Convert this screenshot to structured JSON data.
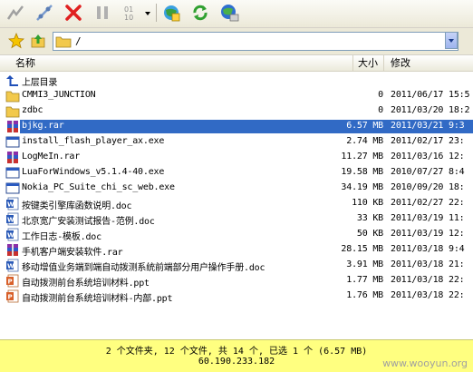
{
  "toolbar": {
    "buttons": [
      {
        "name": "connect-icon"
      },
      {
        "name": "disconnect-icon"
      },
      {
        "name": "stop-icon"
      },
      {
        "name": "pause-icon"
      },
      {
        "name": "transfer-mode-icon"
      },
      {
        "name": "dropdown-arrow-icon"
      },
      {
        "name": "globe-new-icon"
      },
      {
        "name": "refresh-icon"
      },
      {
        "name": "site-manager-icon"
      }
    ]
  },
  "address": {
    "path": "/"
  },
  "columns": {
    "name": "名称",
    "size": "大小",
    "modified": "修改"
  },
  "rows": [
    {
      "icon": "up",
      "name": "上层目录",
      "size": "",
      "date": ""
    },
    {
      "icon": "folder",
      "name": "CMMI3_JUNCTION",
      "size": "0",
      "date": "2011/06/17 15:5"
    },
    {
      "icon": "folder",
      "name": "zdbc",
      "size": "0",
      "date": "2011/03/20 18:2"
    },
    {
      "icon": "rar",
      "name": "bjkg.rar",
      "size": "6.57 MB",
      "date": "2011/03/21 9:3",
      "selected": true
    },
    {
      "icon": "exe",
      "name": "install_flash_player_ax.exe",
      "size": "2.74 MB",
      "date": "2011/02/17 23:"
    },
    {
      "icon": "rar",
      "name": "LogMeIn.rar",
      "size": "11.27 MB",
      "date": "2011/03/16 12:"
    },
    {
      "icon": "exe",
      "name": "LuaForWindows_v5.1.4-40.exe",
      "size": "19.58 MB",
      "date": "2010/07/27 8:4"
    },
    {
      "icon": "exe",
      "name": "Nokia_PC_Suite_chi_sc_web.exe",
      "size": "34.19 MB",
      "date": "2010/09/20 18:"
    },
    {
      "icon": "doc",
      "name": "按键类引擎库函数说明.doc",
      "size": "110 KB",
      "date": "2011/02/27 22:"
    },
    {
      "icon": "doc",
      "name": "北京宽广安装测试报告-范例.doc",
      "size": "33 KB",
      "date": "2011/03/19 11:"
    },
    {
      "icon": "doc",
      "name": "工作日志-模板.doc",
      "size": "50 KB",
      "date": "2011/03/19 12:"
    },
    {
      "icon": "rar",
      "name": "手机客户端安装软件.rar",
      "size": "28.15 MB",
      "date": "2011/03/18 9:4"
    },
    {
      "icon": "doc",
      "name": "移动增值业务端到端自动拨测系统前端部分用户操作手册.doc",
      "size": "3.91 MB",
      "date": "2011/03/18 21:"
    },
    {
      "icon": "ppt",
      "name": "自动拨测前台系统培训材料.ppt",
      "size": "1.77 MB",
      "date": "2011/03/18 22:"
    },
    {
      "icon": "ppt",
      "name": "自动拨测前台系统培训材料-内部.ppt",
      "size": "1.76 MB",
      "date": "2011/03/18 22:"
    }
  ],
  "status": {
    "summary": "2 个文件夹, 12 个文件, 共 14 个, 已选 1 个 (6.57 MB)",
    "host": "60.190.233.182"
  },
  "watermark": "www.wooyun.org",
  "colors": {
    "selection": "#316ac5",
    "statusbar": "#ffff80",
    "folder": "#f2c94c"
  }
}
